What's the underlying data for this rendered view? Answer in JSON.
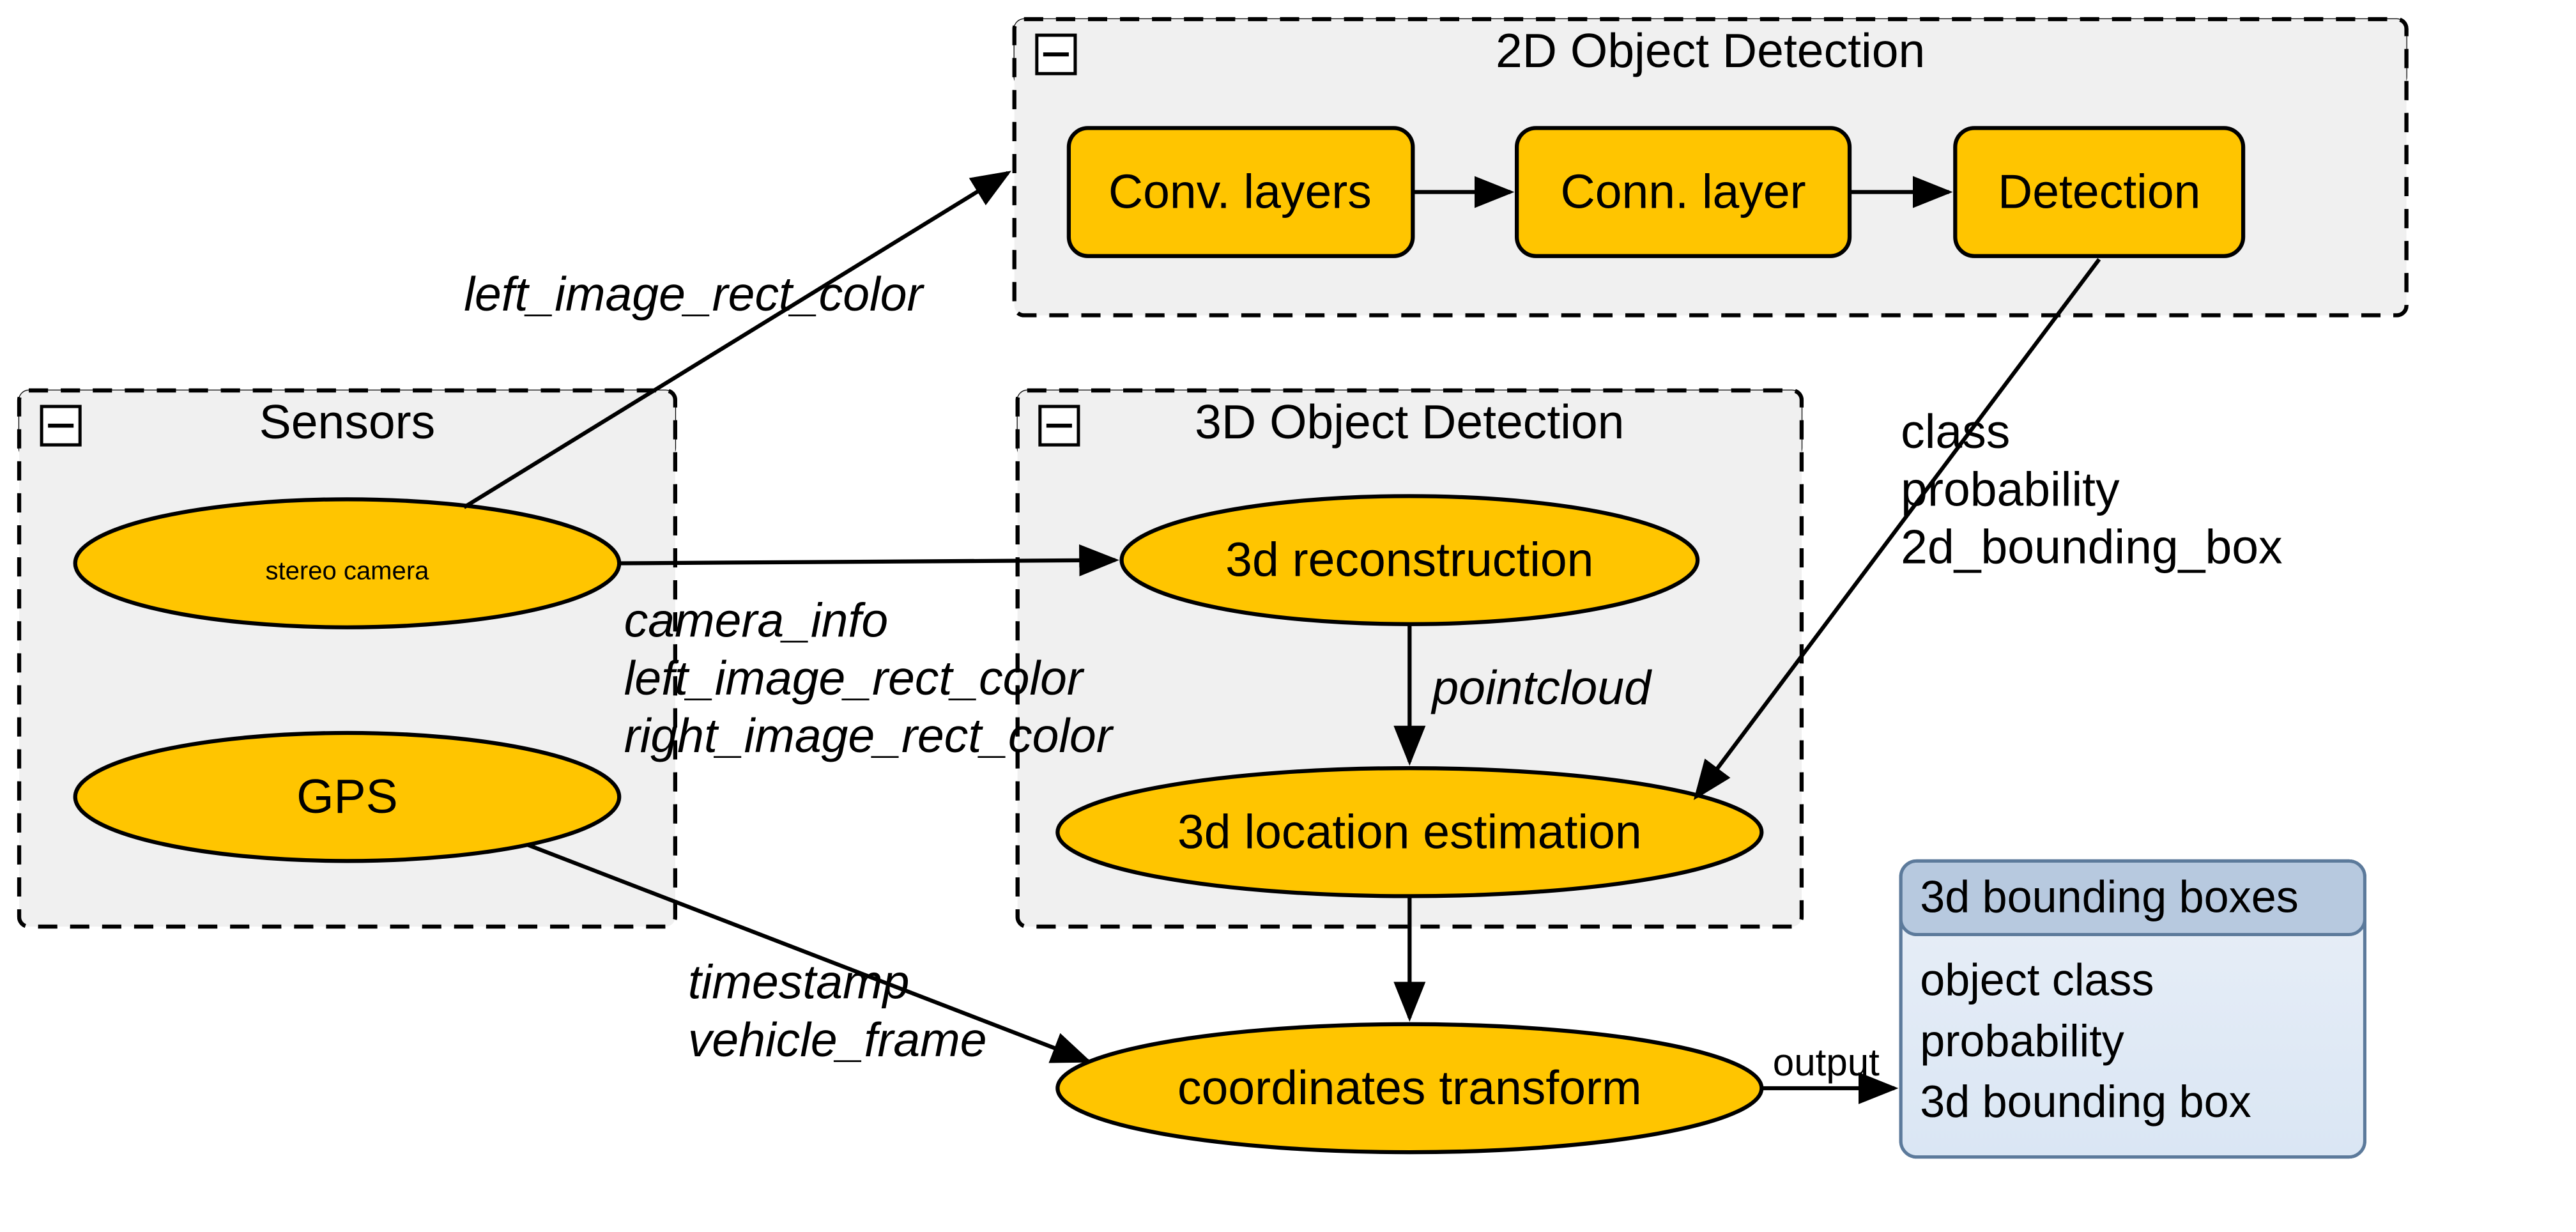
{
  "groups": {
    "sensors": {
      "title": "Sensors"
    },
    "det2d": {
      "title": "2D Object Detection"
    },
    "det3d": {
      "title": "3D Object Detection"
    }
  },
  "nodes": {
    "stereo": {
      "label": "stereo camera"
    },
    "gps": {
      "label": "GPS"
    },
    "conv": {
      "label": "Conv. layers"
    },
    "conn": {
      "label": "Conn. layer"
    },
    "detect": {
      "label": "Detection"
    },
    "recon": {
      "label": "3d reconstruction"
    },
    "locest": {
      "label": "3d location estimation"
    },
    "coord": {
      "label": "coordinates transform"
    }
  },
  "edges": {
    "stereo_to_2d": {
      "label": "left_image_rect_color"
    },
    "stereo_to_3d_l1": {
      "label": "camera_info"
    },
    "stereo_to_3d_l2": {
      "label": "left_image_rect_color"
    },
    "stereo_to_3d_l3": {
      "label": "right_image_rect_color"
    },
    "recon_to_locest": {
      "label": "pointcloud"
    },
    "detect_to_locest_l1": {
      "label": "class"
    },
    "detect_to_locest_l2": {
      "label": "probability"
    },
    "detect_to_locest_l3": {
      "label": "2d_bounding_box"
    },
    "gps_to_coord_l1": {
      "label": "timestamp"
    },
    "gps_to_coord_l2": {
      "label": "vehicle_frame"
    },
    "coord_to_out": {
      "label": "output"
    }
  },
  "output": {
    "title": "3d bounding boxes",
    "lines": [
      "object class",
      "probability",
      "3d bounding box"
    ]
  }
}
